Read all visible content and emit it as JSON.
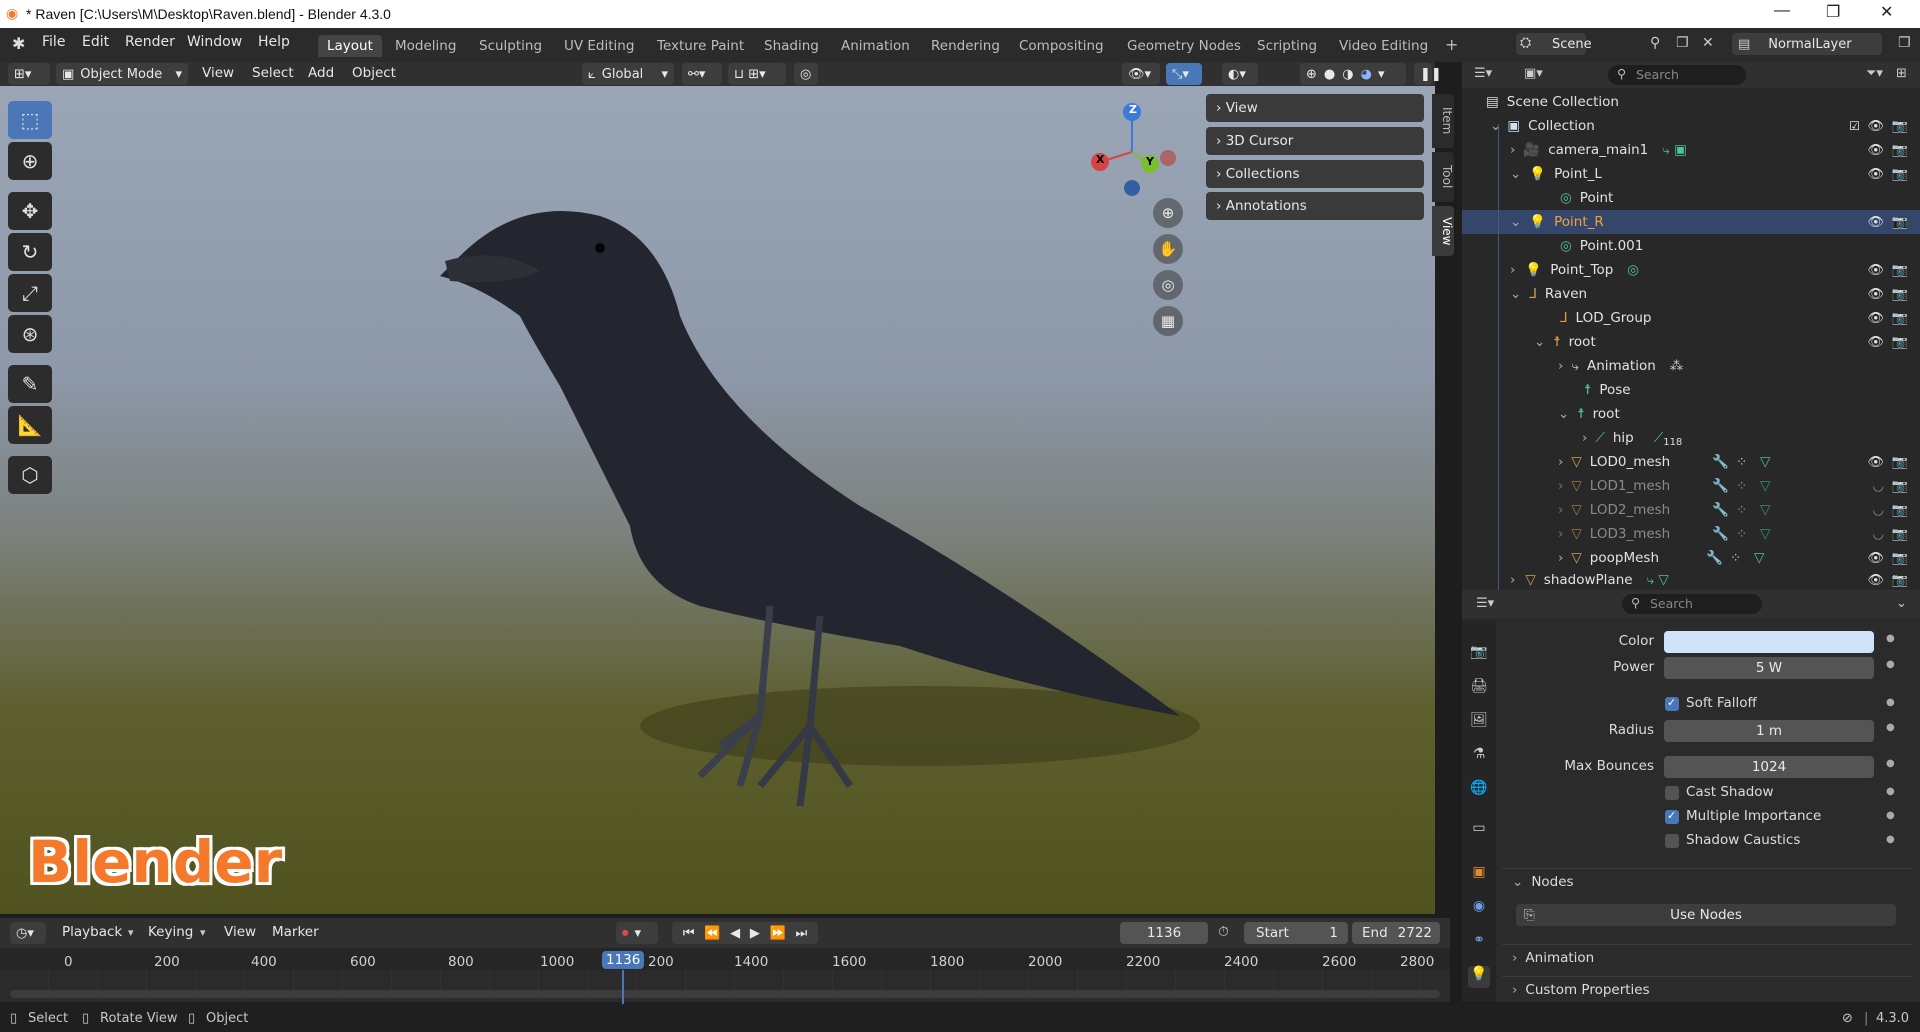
{
  "titlebar": {
    "title": "* Raven [C:\\Users\\M\\Desktop\\Raven.blend] - Blender 4.3.0",
    "minimize": "—",
    "maximize": "❐",
    "close": "✕"
  },
  "menus": [
    "File",
    "Edit",
    "Render",
    "Window",
    "Help"
  ],
  "workspaces": [
    "Layout",
    "Modeling",
    "Sculpting",
    "UV Editing",
    "Texture Paint",
    "Shading",
    "Animation",
    "Rendering",
    "Compositing",
    "Geometry Nodes",
    "Scripting",
    "Video Editing"
  ],
  "add_workspace": "+",
  "scene": {
    "label": "Scene",
    "view_layer": "NormalLayer"
  },
  "viewport_header": {
    "mode": "Object Mode",
    "view": "View",
    "select": "Select",
    "add": "Add",
    "object": "Object",
    "orientation": "Global"
  },
  "gizmo": {
    "x": "X",
    "y": "Y",
    "z": "Z"
  },
  "npanel": {
    "items": [
      "View",
      "3D Cursor",
      "Collections",
      "Annotations"
    ]
  },
  "side_tabs": [
    "Item",
    "Tool",
    "View"
  ],
  "watermark": "Blender",
  "outliner": {
    "search_placeholder": "Search",
    "scene_collection": "Scene Collection",
    "rows": [
      {
        "label": "Collection",
        "icon": "collection-icon"
      },
      {
        "label": "camera_main1",
        "icon": "camera-icon"
      },
      {
        "label": "Point_L",
        "icon": "light-icon"
      },
      {
        "label": "Point",
        "icon": "light-data-icon"
      },
      {
        "label": "Point_R",
        "icon": "light-icon"
      },
      {
        "label": "Point.001",
        "icon": "light-data-icon"
      },
      {
        "label": "Point_Top",
        "icon": "light-icon"
      },
      {
        "label": "Raven",
        "icon": "empty-icon"
      },
      {
        "label": "LOD_Group",
        "icon": "empty-icon"
      },
      {
        "label": "root",
        "icon": "armature-icon"
      },
      {
        "label": "Animation",
        "icon": "action-icon"
      },
      {
        "label": "Pose",
        "icon": "pose-icon"
      },
      {
        "label": "root",
        "icon": "armature-data-icon"
      },
      {
        "label": "hip",
        "icon": "bone-icon",
        "badge": "118"
      },
      {
        "label": "LOD0_mesh",
        "icon": "mesh-icon"
      },
      {
        "label": "LOD1_mesh",
        "icon": "mesh-icon"
      },
      {
        "label": "LOD2_mesh",
        "icon": "mesh-icon"
      },
      {
        "label": "LOD3_mesh",
        "icon": "mesh-icon"
      },
      {
        "label": "poopMesh",
        "icon": "mesh-icon"
      },
      {
        "label": "shadowPlane",
        "icon": "mesh-icon"
      }
    ]
  },
  "properties": {
    "search_placeholder": "Search",
    "color_label": "Color",
    "color_value": "#cfe3fb",
    "power_label": "Power",
    "power_value": "5 W",
    "soft_falloff": "Soft Falloff",
    "radius_label": "Radius",
    "radius_value": "1 m",
    "max_bounces_label": "Max Bounces",
    "max_bounces_value": "1024",
    "cast_shadow": "Cast Shadow",
    "multiple_importance": "Multiple Importance",
    "shadow_caustics": "Shadow Caustics",
    "nodes": "Nodes",
    "use_nodes": "Use Nodes",
    "animation": "Animation",
    "custom_properties": "Custom Properties"
  },
  "timeline": {
    "playback": "Playback",
    "keying": "Keying",
    "view": "View",
    "marker": "Marker",
    "current_frame": "1136",
    "start_label": "Start",
    "start_value": "1",
    "end_label": "End",
    "end_value": "2722",
    "ticks": [
      "0",
      "200",
      "400",
      "600",
      "800",
      "1000",
      "1136",
      "200",
      "1400",
      "1600",
      "1800",
      "2000",
      "2200",
      "2400",
      "2600",
      "2800"
    ]
  },
  "statusbar": {
    "select": "Select",
    "rotate": "Rotate View",
    "object": "Object",
    "version": "4.3.0"
  }
}
